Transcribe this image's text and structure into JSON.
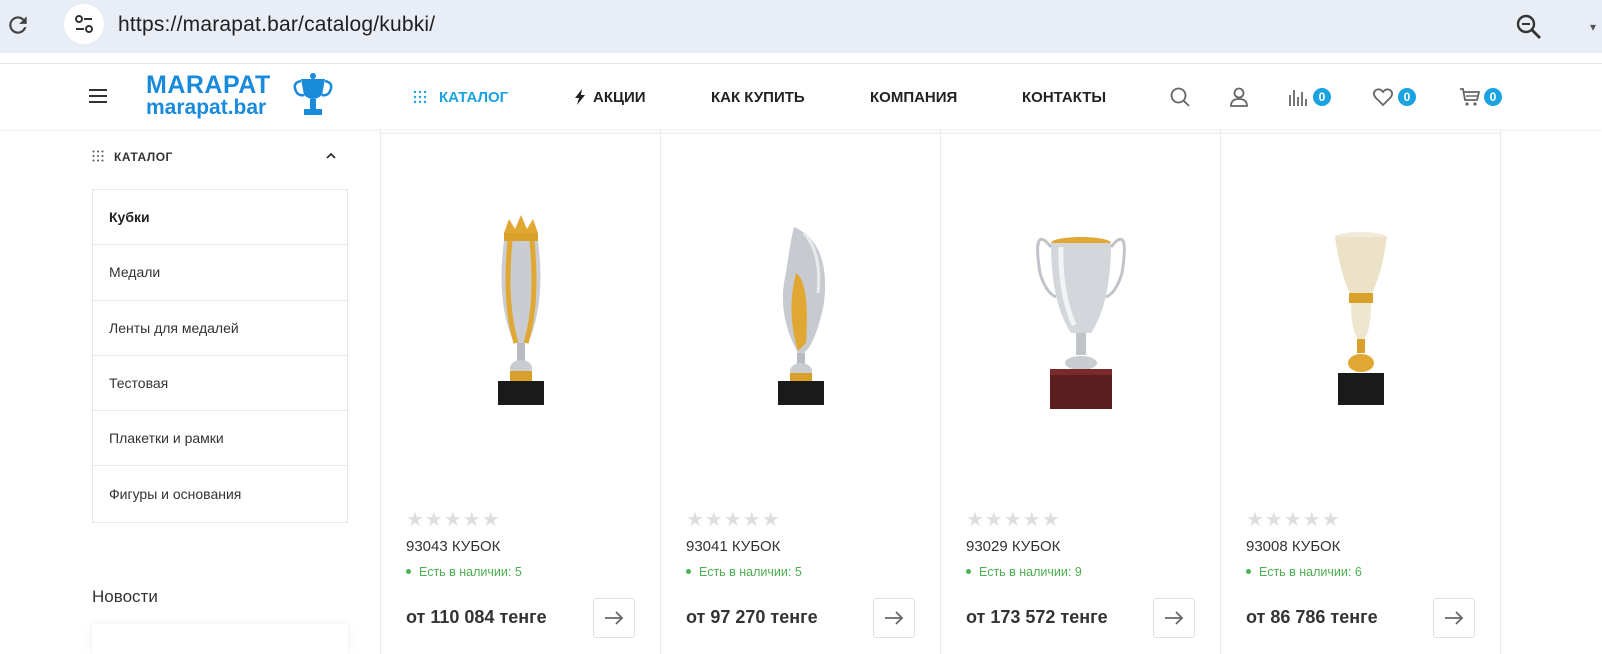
{
  "browser": {
    "url": "https://marapat.bar/catalog/kubki/"
  },
  "logo": {
    "line1": "MARAPAT",
    "line2": "marapat.bar"
  },
  "nav": {
    "catalog": "КАТАЛОГ",
    "promo": "АКЦИИ",
    "how_to_buy": "КАК КУПИТЬ",
    "company": "КОМПАНИЯ",
    "contacts": "КОНТАКТЫ"
  },
  "header_counters": {
    "compare": "0",
    "favorites": "0",
    "cart": "0"
  },
  "sidebar": {
    "title": "КАТАЛОГ",
    "items": [
      {
        "label": "Кубки"
      },
      {
        "label": "Медали"
      },
      {
        "label": "Ленты для медалей"
      },
      {
        "label": "Тестовая"
      },
      {
        "label": "Плакетки и рамки"
      },
      {
        "label": "Фигуры и основания"
      }
    ],
    "news_title": "Новости"
  },
  "products": [
    {
      "name": "93043 КУБОК",
      "stock": "Есть в наличии: 5",
      "price": "от 110 084 тенге",
      "stars": "★★★★★",
      "rating": 0
    },
    {
      "name": "93041 КУБОК",
      "stock": "Есть в наличии: 5",
      "price": "от 97 270 тенге",
      "stars": "★★★★★",
      "rating": 0
    },
    {
      "name": "93029 КУБОК",
      "stock": "Есть в наличии: 9",
      "price": "от 173 572 тенге",
      "stars": "★★★★★",
      "rating": 0
    },
    {
      "name": "93008 КУБОК",
      "stock": "Есть в наличии: 6",
      "price": "от 86 786 тенге",
      "stars": "★★★★★",
      "rating": 0
    }
  ],
  "colors": {
    "accent": "#1aa3e0",
    "logo": "#1a8bdb",
    "in_stock": "#4caf50"
  }
}
